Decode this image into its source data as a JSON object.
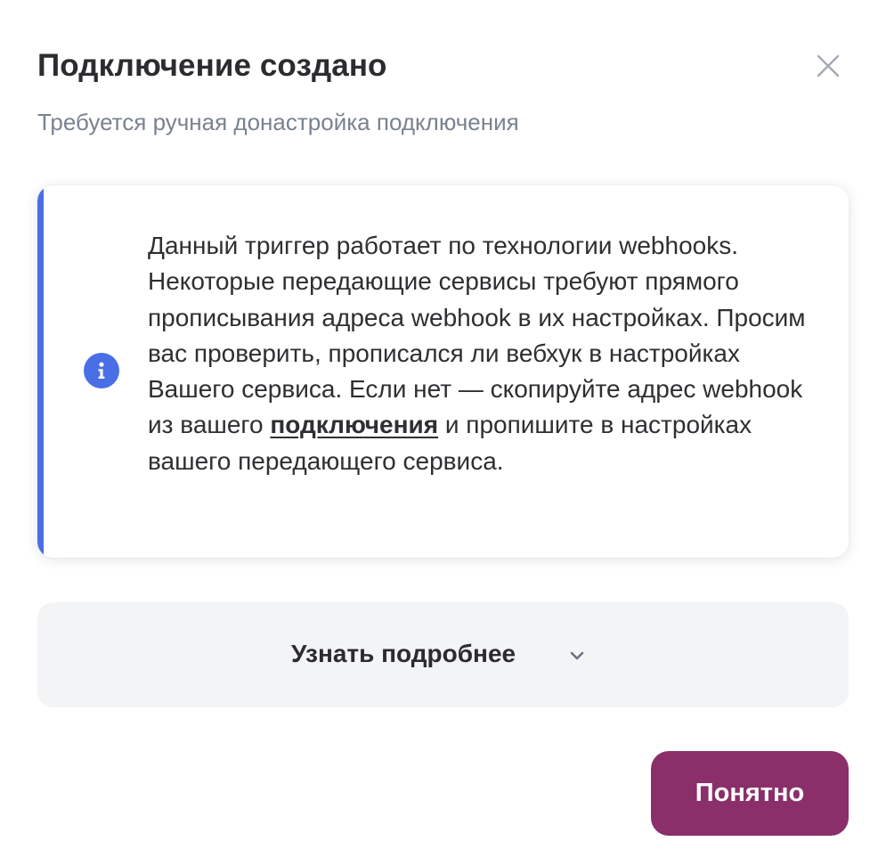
{
  "dialog": {
    "title": "Подключение создано",
    "subtitle": "Требуется ручная донастройка подключения",
    "close_icon": "close-icon"
  },
  "info": {
    "icon": "info-icon",
    "accent_color": "#4a6ee6",
    "text_before_link": "Данный триггер работает по технологии webhooks. Некоторые передающие сервисы требуют прямого прописывания адреса webhook в их настройках. Просим вас проверить, прописался ли вебхук в настройках Вашего сервиса. Если нет — скопируйте адрес webhook из вашего ",
    "link_text": "подключения",
    "text_after_link": " и пропишите в настройках вашего передающего сервиса."
  },
  "more": {
    "label": "Узнать подробнее",
    "icon": "chevron-down-icon"
  },
  "actions": {
    "ok_label": "Понятно",
    "ok_color": "#8a2f6a"
  }
}
